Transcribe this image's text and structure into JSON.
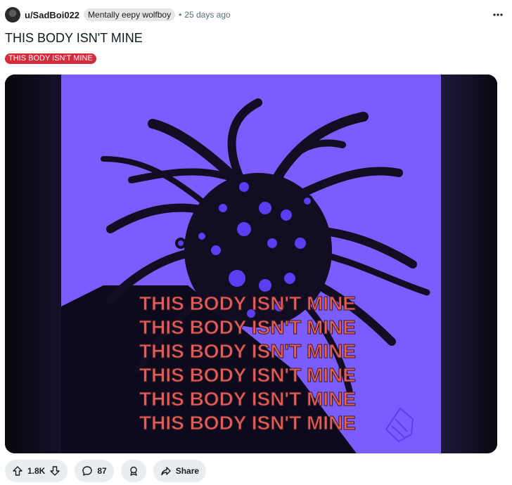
{
  "post": {
    "author": "u/SadBoi022",
    "author_flair": "Mentally eepy wolfboy",
    "separator": "•",
    "age": "25 days ago",
    "title": "THIS BODY ISN'T MINE",
    "post_flair": "THIS BODY ISN'T MINE",
    "more_icon": "more-options-icon",
    "image_text_lines": [
      "THIS BODY ISN'T MINE",
      "THIS BODY ISN'T MINE",
      "THIS BODY ISN'T MINE",
      "THIS BODY ISN'T MINE",
      "THIS BODY ISN'T MINE",
      "THIS BODY ISN'T MINE"
    ]
  },
  "actions": {
    "vote_count": "1.8K",
    "comment_count": "87",
    "share_label": "Share"
  },
  "colors": {
    "flair_red": "#d42c3d",
    "image_purple": "#7b5cff",
    "image_text_red": "#e35d5d"
  }
}
